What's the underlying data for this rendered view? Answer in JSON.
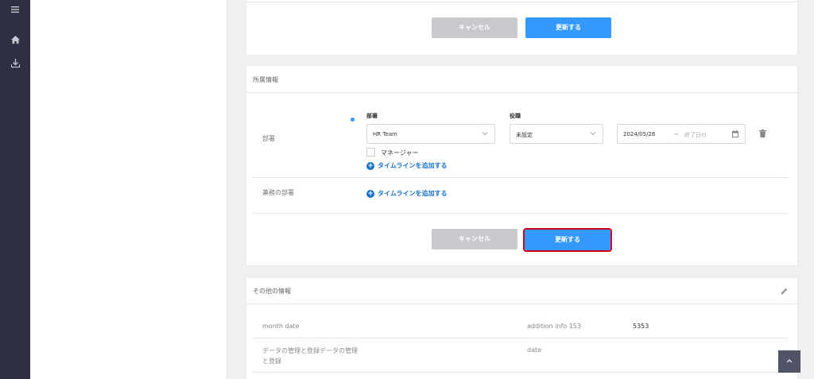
{
  "top_card": {
    "cancel_label": "キャンセル",
    "update_label": "更新する"
  },
  "affiliation": {
    "title": "所属情報",
    "dept_row_label": "部署",
    "dept_field_label": "部署",
    "dept_value": "HR Team",
    "role_field_label": "役職",
    "role_value": "未設定",
    "start_date": "2024/05/26",
    "date_arrow": "→",
    "end_placeholder": "終了日付",
    "manager_label": "マネージャー",
    "add_timeline_label": "タイムラインを追加する",
    "concurrent_row_label": "兼務の部署",
    "add_timeline_label_2": "タイムラインを追加する",
    "cancel_label": "キャンセル",
    "update_label": "更新する"
  },
  "other_info": {
    "title": "その他の情報",
    "row1_label": "month date",
    "row1_field": "addition info 153",
    "row1_value": "5353",
    "row2_label_line1": "データの管理と登録データの管理",
    "row2_label_line2": "と登録",
    "row2_field": "date"
  },
  "icons": {
    "menu": "menu-icon",
    "home": "home-icon",
    "download": "download-icon",
    "edit": "pencil-icon",
    "trash": "trash-icon",
    "calendar": "calendar-icon",
    "scroll_top": "chevron-up-icon"
  },
  "colors": {
    "primary": "#3399ff",
    "sidebar": "#2c3041",
    "focus": "#d0021b"
  }
}
